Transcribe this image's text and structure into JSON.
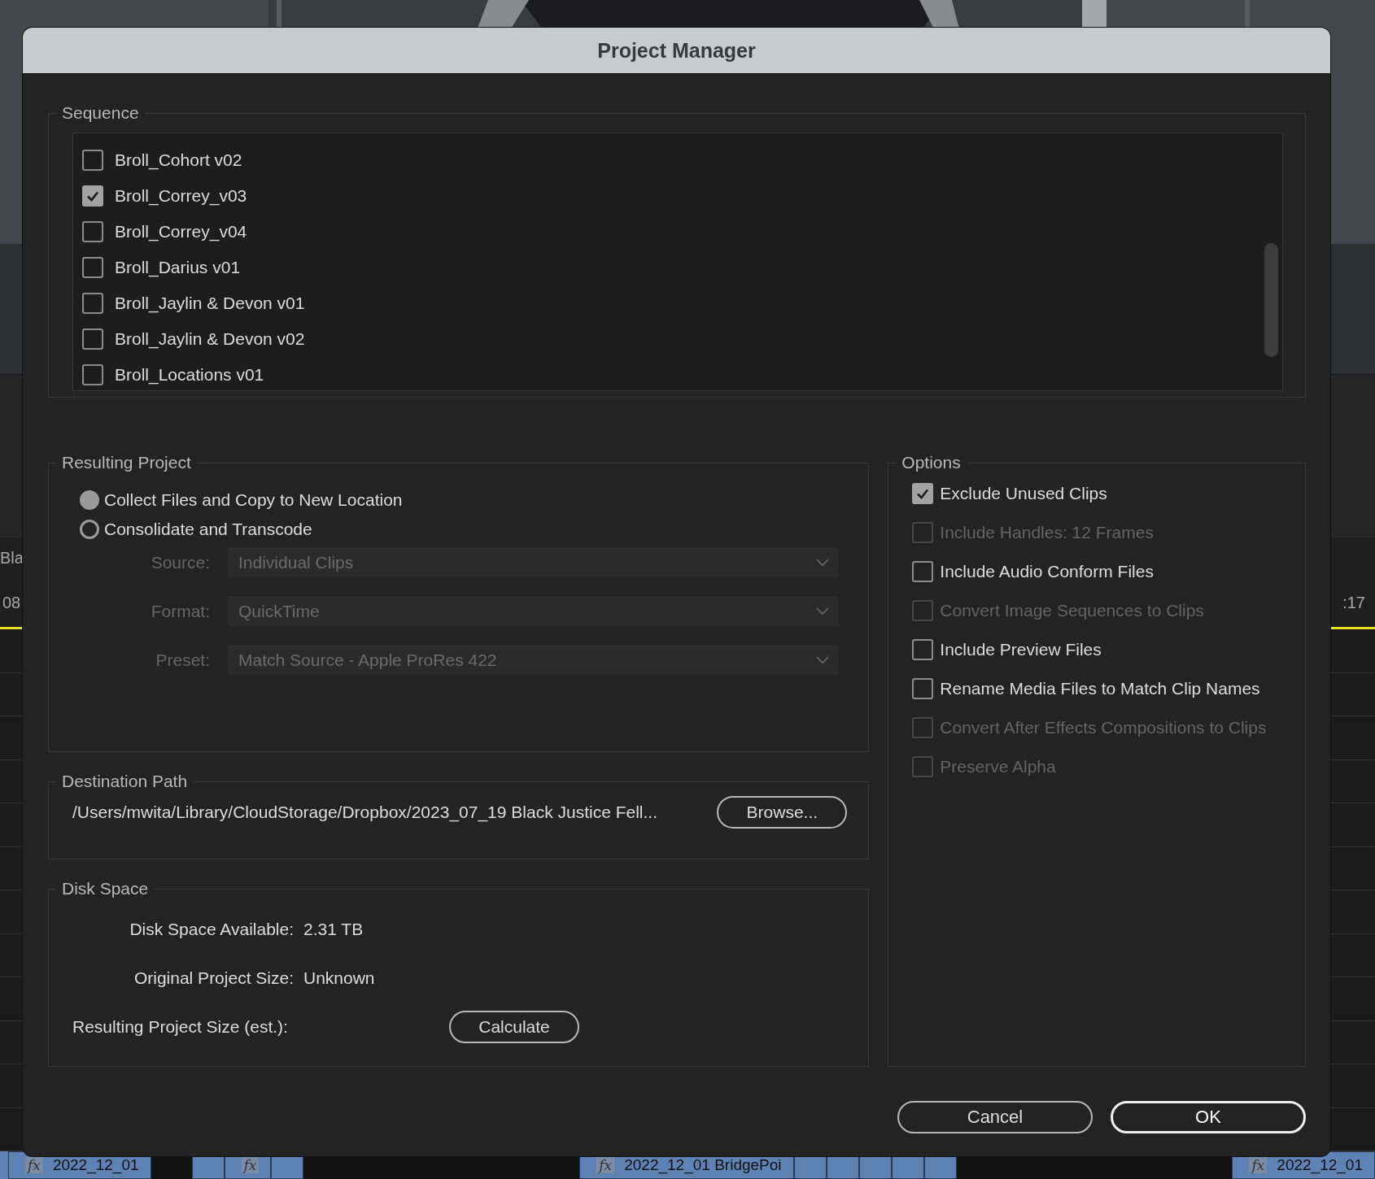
{
  "background": {
    "left_labels": [
      "Bla",
      "08"
    ],
    "right_labels": [
      ":17"
    ],
    "timeline_clips": [
      {
        "kind": "marker"
      },
      {
        "kind": "clip",
        "fx": "fx",
        "label": "2022_12_01"
      },
      {
        "kind": "gap"
      },
      {
        "kind": "block"
      },
      {
        "kind": "clip",
        "fx": "fx"
      },
      {
        "kind": "block"
      },
      {
        "kind": "wide-gap"
      },
      {
        "kind": "clip",
        "fx": "fx",
        "label": "2022_12_01 BridgePoi"
      },
      {
        "kind": "block"
      },
      {
        "kind": "block"
      },
      {
        "kind": "block"
      },
      {
        "kind": "block"
      },
      {
        "kind": "block"
      },
      {
        "kind": "wide-gap"
      },
      {
        "kind": "clip",
        "fx": "fx",
        "label": "2022_12_01"
      }
    ]
  },
  "dialog": {
    "title": "Project Manager"
  },
  "sequence": {
    "legend": "Sequence",
    "items": [
      {
        "label": "Broll_Cohort v02",
        "checked": false
      },
      {
        "label": "Broll_Correy_v03",
        "checked": true
      },
      {
        "label": "Broll_Correy_v04",
        "checked": false
      },
      {
        "label": "Broll_Darius v01",
        "checked": false
      },
      {
        "label": "Broll_Jaylin & Devon v01",
        "checked": false
      },
      {
        "label": "Broll_Jaylin & Devon v02",
        "checked": false
      },
      {
        "label": "Broll_Locations v01",
        "checked": false
      }
    ]
  },
  "resulting_project": {
    "legend": "Resulting Project",
    "choices": [
      {
        "label": "Collect Files and Copy to New Location",
        "selected": true
      },
      {
        "label": "Consolidate and Transcode",
        "selected": false
      }
    ],
    "fields": [
      {
        "label": "Source:",
        "value": "Individual Clips",
        "disabled": true
      },
      {
        "label": "Format:",
        "value": "QuickTime",
        "disabled": true
      },
      {
        "label": "Preset:",
        "value": "Match Source - Apple ProRes 422",
        "disabled": true
      }
    ]
  },
  "destination_path": {
    "legend": "Destination Path",
    "path": "/Users/mwita/Library/CloudStorage/Dropbox/2023_07_19 Black Justice Fell...",
    "button": "Browse..."
  },
  "disk_space": {
    "legend": "Disk Space",
    "rows": [
      {
        "label": "Disk Space Available:",
        "value": "2.31 TB"
      },
      {
        "label": "Original Project Size:",
        "value": "Unknown"
      }
    ],
    "estimate_label": "Resulting Project Size (est.):",
    "button": "Calculate"
  },
  "options": {
    "legend": "Options",
    "items": [
      {
        "label": "Exclude Unused Clips",
        "checked": true,
        "disabled": false
      },
      {
        "label": "Include Handles:  12 Frames",
        "checked": false,
        "disabled": true
      },
      {
        "label": "Include Audio Conform Files",
        "checked": false,
        "disabled": false
      },
      {
        "label": "Convert Image Sequences to Clips",
        "checked": false,
        "disabled": true
      },
      {
        "label": "Include Preview Files",
        "checked": false,
        "disabled": false
      },
      {
        "label": "Rename Media Files to Match Clip Names",
        "checked": false,
        "disabled": false
      },
      {
        "label": "Convert After Effects Compositions to Clips",
        "checked": false,
        "disabled": true
      },
      {
        "label": "Preserve Alpha",
        "checked": false,
        "disabled": true
      }
    ]
  },
  "buttons": [
    {
      "label": "Cancel",
      "default": false
    },
    {
      "label": "OK",
      "default": true
    }
  ]
}
